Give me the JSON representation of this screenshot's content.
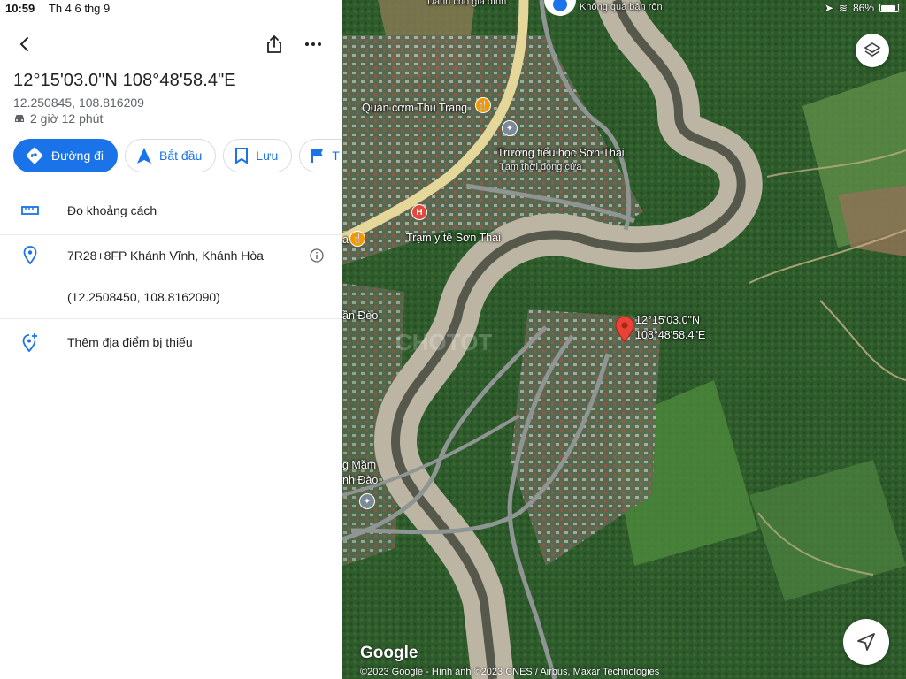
{
  "status": {
    "time": "10:59",
    "date": "Th 4 6 thg 9",
    "battery": "86%"
  },
  "place": {
    "title": "12°15'03.0\"N 108°48'58.4\"E",
    "decimal": "12.250845, 108.816209",
    "eta": "2 giờ 12 phút"
  },
  "actions": {
    "directions": "Đường đi",
    "start": "Bắt đầu",
    "save": "Lưu",
    "more": "T"
  },
  "rows": {
    "measure": "Đo khoảng cách",
    "plus_code": "7R28+8FP Khánh Vĩnh, Khánh Hòa",
    "coords": "(12.2508450, 108.8162090)",
    "add_place": "Thêm địa điểm bị thiếu"
  },
  "map": {
    "labels": {
      "top_left": "Dành cho gia đình",
      "top_mid": "Không quá bận rộn",
      "restaurant": "Quán cơm Thu Trang",
      "school": "Trường tiểu học Sơn Thái",
      "school_status": "Tạm thời đóng cửa",
      "clinic": "Trạm y tế Sơn Thái",
      "left_edge_1": "a",
      "left_edge_2": "ần Đèo",
      "left_edge_3": "g Mầm",
      "left_edge_4": "nh Đào",
      "pin_label_1": "12°15'03.0\"N",
      "pin_label_2": "108°48'58.4\"E"
    },
    "watermark": "CHOTOT",
    "logo": "Google",
    "attribution": "©2023 Google - Hình ảnh ©2023 CNES / Airbus, Maxar Technologies"
  },
  "colors": {
    "accent": "#1a73e8",
    "pin": "#ea4335",
    "poi_food": "#f29900",
    "poi_health": "#e8453c"
  }
}
